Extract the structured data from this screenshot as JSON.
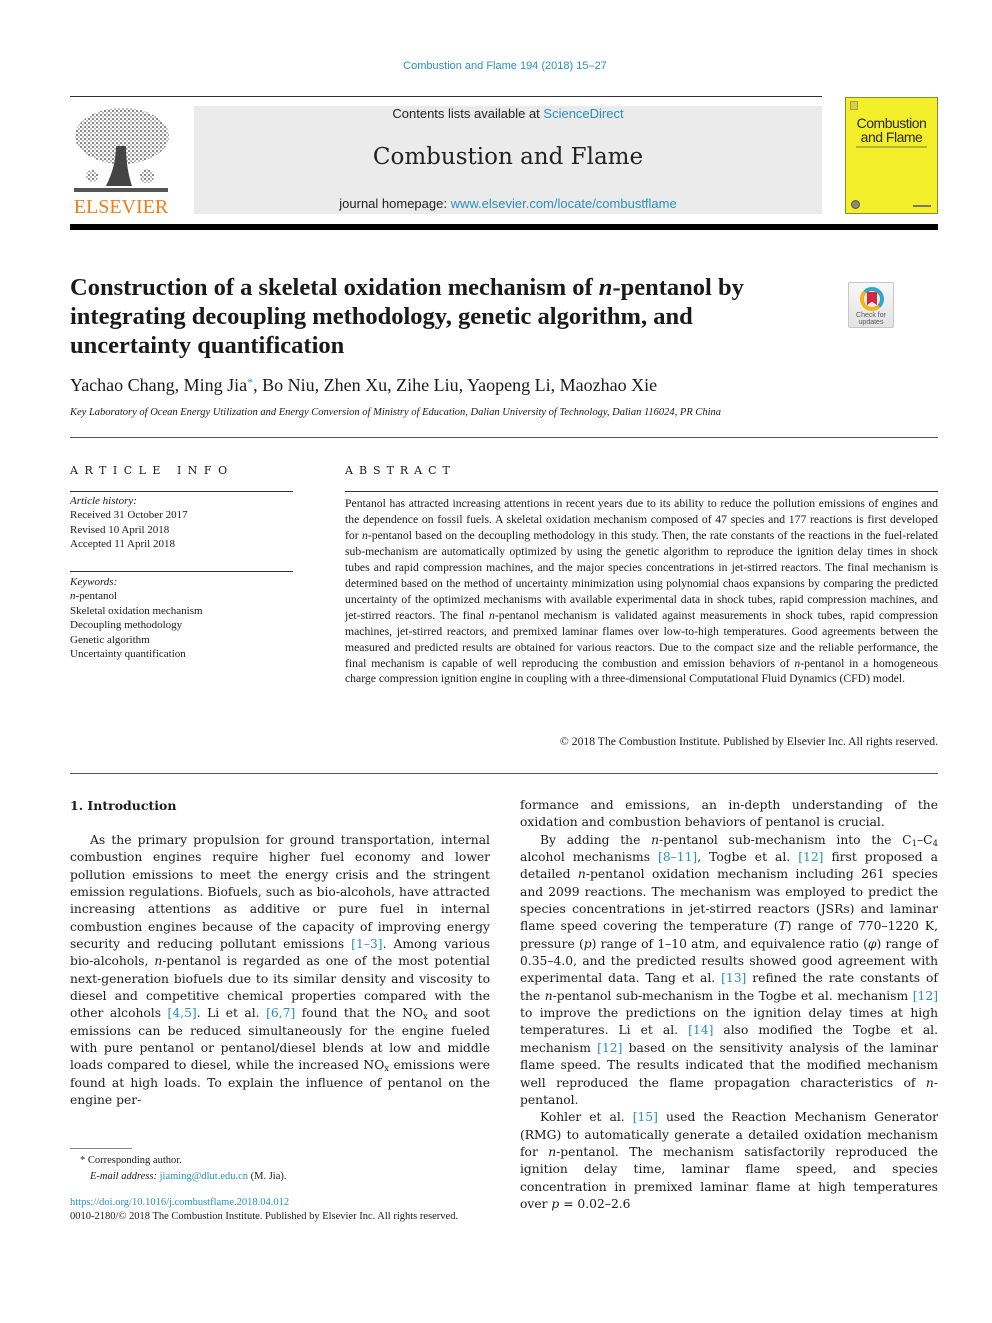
{
  "journal_ref": "Combustion and Flame 194 (2018) 15–27",
  "header": {
    "publisher_wordmark": "ELSEVIER",
    "contents_prefix": "Contents lists available at ",
    "contents_link": "ScienceDirect",
    "journal_title": "Combustion and Flame",
    "homepage_prefix": "journal homepage: ",
    "homepage_link": "www.elsevier.com/locate/combustflame",
    "cover_title_line1": "Combustion",
    "cover_title_line2": "and Flame",
    "brand_color": "#f07e15",
    "link_color": "#2a8fbd",
    "cover_color": "#f3ef2a"
  },
  "check_updates": {
    "line1": "Check for",
    "line2": "updates",
    "icon": "check-for-updates-icon"
  },
  "article": {
    "title_part1": "Construction of a skeletal oxidation mechanism of ",
    "title_italic": "n",
    "title_part2": "-pentanol by integrating decoupling methodology, genetic algorithm, and uncertainty quantification",
    "authors_before": "Yachao Chang, Ming Jia",
    "corresponding_mark": "*",
    "authors_after": ", Bo Niu, Zhen Xu, Zihe Liu, Yaopeng Li, Maozhao Xie",
    "affiliation": "Key Laboratory of Ocean Energy Utilization and Energy Conversion of Ministry of Education, Dalian University of Technology, Dalian 116024, PR China"
  },
  "article_info": {
    "heading": "ARTICLE INFO",
    "history_label": "Article history:",
    "history": [
      "Received 31 October 2017",
      "Revised 10 April 2018",
      "Accepted 11 April 2018"
    ],
    "keywords_label": "Keywords:",
    "keywords": [
      {
        "italic": "n",
        "rest": "-pentanol"
      },
      {
        "italic": "",
        "rest": "Skeletal oxidation mechanism"
      },
      {
        "italic": "",
        "rest": "Decoupling methodology"
      },
      {
        "italic": "",
        "rest": "Genetic algorithm"
      },
      {
        "italic": "",
        "rest": "Uncertainty quantification"
      }
    ]
  },
  "abstract": {
    "heading": "ABSTRACT",
    "segments": [
      {
        "t": "Pentanol has attracted increasing attentions in recent years due to its ability to reduce the pollution emissions of engines and the dependence on fossil fuels. A skeletal oxidation mechanism composed of 47 species and 177 reactions is first developed for "
      },
      {
        "i": "n"
      },
      {
        "t": "-pentanol based on the decoupling methodology in this study. Then, the rate constants of the reactions in the fuel-related sub-mechanism are automatically optimized by using the genetic algorithm to reproduce the ignition delay times in shock tubes and rapid compression machines, and the major species concentrations in jet-stirred reactors. The final mechanism is determined based on the method of uncertainty minimization using polynomial chaos expansions by comparing the predicted uncertainty of the optimized mechanisms with available experimental data in shock tubes, rapid compression machines, and jet-stirred reactors. The final "
      },
      {
        "i": "n"
      },
      {
        "t": "-pentanol mechanism is validated against measurements in shock tubes, rapid compression machines, jet-stirred reactors, and premixed laminar flames over low-to-high temperatures. Good agreements between the measured and predicted results are obtained for various reactors. Due to the compact size and the reliable performance, the final mechanism is capable of well reproducing the combustion and emission behaviors of "
      },
      {
        "i": "n"
      },
      {
        "t": "-pentanol in a homogeneous charge compression ignition engine in coupling with a three-dimensional Computational Fluid Dynamics (CFD) model."
      }
    ],
    "copyright": "© 2018 The Combustion Institute. Published by Elsevier Inc. All rights reserved."
  },
  "introduction": {
    "heading": "1. Introduction",
    "left_paragraph": [
      {
        "t": "As the primary propulsion for ground transportation, internal combustion engines require higher fuel economy and lower pollution emissions to meet the energy crisis and the stringent emission regulations. Biofuels, such as bio-alcohols, have attracted increasing attentions as additive or pure fuel in internal combustion engines because of the capacity of improving energy security and reducing pollutant emissions "
      },
      {
        "ref": "[1–3]"
      },
      {
        "t": ". Among various bio-alcohols, "
      },
      {
        "i": "n"
      },
      {
        "t": "-pentanol is regarded as one of the most potential next-generation biofuels due to its similar density and viscosity to diesel and competitive chemical properties compared with the other alcohols "
      },
      {
        "ref": "[4,5]"
      },
      {
        "t": ". Li et al. "
      },
      {
        "ref": "[6,7]"
      },
      {
        "t": " found that the NO"
      },
      {
        "sub": "x"
      },
      {
        "t": " and soot emissions can be reduced simultaneously for the engine fueled with pure pentanol or pentanol/diesel blends at low and middle loads compared to diesel, while the increased NO"
      },
      {
        "sub": "x"
      },
      {
        "t": " emissions were found at high loads. To explain the influence of pentanol on the engine per-"
      }
    ],
    "right_paragraphs": [
      {
        "indent": false,
        "segments": [
          {
            "t": "formance and emissions, an in-depth understanding of the oxidation and combustion behaviors of pentanol is crucial."
          }
        ]
      },
      {
        "indent": true,
        "segments": [
          {
            "t": "By adding the "
          },
          {
            "i": "n"
          },
          {
            "t": "-pentanol sub-mechanism into the C"
          },
          {
            "sub": "1"
          },
          {
            "t": "–C"
          },
          {
            "sub": "4"
          },
          {
            "t": " alcohol mechanisms "
          },
          {
            "ref": "[8–11]"
          },
          {
            "t": ", Togbe et al. "
          },
          {
            "ref": "[12]"
          },
          {
            "t": " first proposed a detailed "
          },
          {
            "i": "n"
          },
          {
            "t": "-pentanol oxidation mechanism including 261 species and 2099 reactions. The mechanism was employed to predict the species concentrations in jet-stirred reactors (JSRs) and laminar flame speed covering the temperature ("
          },
          {
            "i": "T"
          },
          {
            "t": ") range of 770–1220 K, pressure ("
          },
          {
            "i": "p"
          },
          {
            "t": ") range of 1–10 atm, and equivalence ratio ("
          },
          {
            "i": "φ"
          },
          {
            "t": ") range of 0.35–4.0, and the predicted results showed good agreement with experimental data. Tang et al. "
          },
          {
            "ref": "[13]"
          },
          {
            "t": " refined the rate constants of the "
          },
          {
            "i": "n"
          },
          {
            "t": "-pentanol sub-mechanism in the Togbe et al. mechanism "
          },
          {
            "ref": "[12]"
          },
          {
            "t": " to improve the predictions on the ignition delay times at high temperatures. Li et al. "
          },
          {
            "ref": "[14]"
          },
          {
            "t": " also modified the Togbe et al. mechanism "
          },
          {
            "ref": "[12]"
          },
          {
            "t": " based on the sensitivity analysis of the laminar flame speed. The results indicated that the modified mechanism well reproduced the flame propagation characteristics of "
          },
          {
            "i": "n"
          },
          {
            "t": "-pentanol."
          }
        ]
      },
      {
        "indent": true,
        "segments": [
          {
            "t": "Kohler et al. "
          },
          {
            "ref": "[15]"
          },
          {
            "t": " used the Reaction Mechanism Generator (RMG) to automatically generate a detailed oxidation mechanism for "
          },
          {
            "i": "n"
          },
          {
            "t": "-pentanol. The mechanism satisfactorily reproduced the ignition delay time, laminar flame speed, and species concentration in premixed laminar flame at high temperatures over "
          },
          {
            "i": "p"
          },
          {
            "t": " = 0.02–2.6"
          }
        ]
      }
    ]
  },
  "footnote": {
    "mark": "*",
    "corresponding": "Corresponding author.",
    "email_label": "E-mail address:",
    "email": "jiaming@dlut.edu.cn",
    "email_suffix": " (M. Jia)."
  },
  "doi": "https://doi.org/10.1016/j.combustflame.2018.04.012",
  "issn_line": "0010-2180/© 2018 The Combustion Institute. Published by Elsevier Inc. All rights reserved."
}
